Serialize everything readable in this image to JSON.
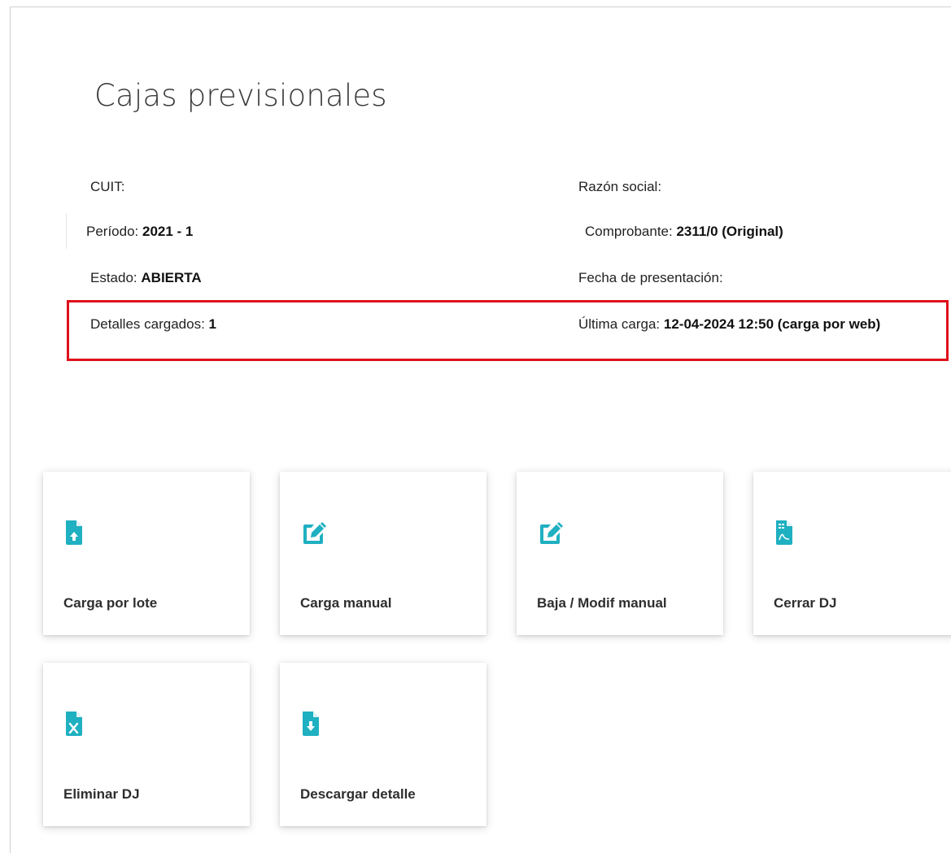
{
  "page": {
    "title": "Cajas previsionales"
  },
  "info": {
    "cuit_label": "CUIT:",
    "razon_social_label": "Razón social:",
    "periodo_label": "Período:",
    "periodo_value": "2021 - 1",
    "comprobante_label": "Comprobante:",
    "comprobante_value": "2311/0 (Original)",
    "estado_label": "Estado:",
    "estado_value": "ABIERTA",
    "fecha_presentacion_label": "Fecha de presentación:",
    "detalles_label": "Detalles cargados:",
    "detalles_value": "1",
    "ultima_carga_label": "Última carga:",
    "ultima_carga_value": "12-04-2024 12:50 (carga por web)"
  },
  "actions": [
    {
      "label": "Carga por lote",
      "icon": "file-upload-icon"
    },
    {
      "label": "Carga manual",
      "icon": "edit-icon"
    },
    {
      "label": "Baja / Modif manual",
      "icon": "edit-icon"
    },
    {
      "label": "Cerrar DJ",
      "icon": "file-pdf-icon"
    },
    {
      "label": "Eliminar DJ",
      "icon": "file-excel-icon"
    },
    {
      "label": "Descargar detalle",
      "icon": "file-download-icon"
    }
  ],
  "colors": {
    "accent": "#1fb0c1",
    "highlight_border": "#e0101b"
  }
}
